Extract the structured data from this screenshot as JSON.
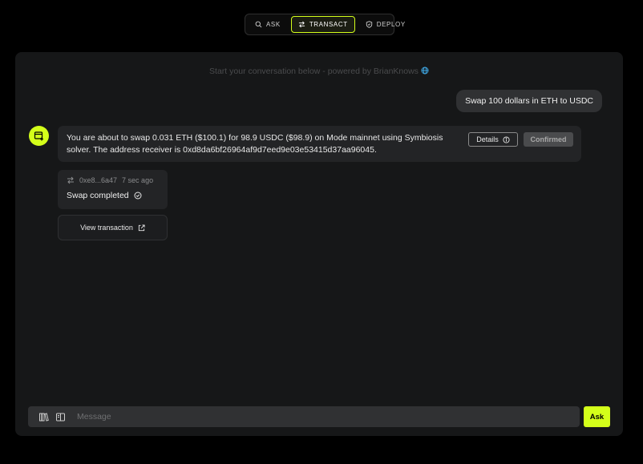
{
  "modes": [
    {
      "label": "ASK",
      "icon": "search-icon",
      "active": false
    },
    {
      "label": "TRANSACT",
      "icon": "swap-icon",
      "active": true
    },
    {
      "label": "DEPLOY",
      "icon": "shield-icon",
      "active": false
    }
  ],
  "intro": {
    "text": "Start your conversation below - powered by BrianKnows"
  },
  "user_message": "Swap 100 dollars in ETH to USDC",
  "bot_message": {
    "text": "You are about to swap 0.031 ETH ($100.1) for 98.9 USDC ($98.9) on Mode mainnet using Symbiosis solver. The address receiver is 0xd8da6bf26964af9d7eed9e03e53415d37aa96045.",
    "details_label": "Details",
    "confirmed_label": "Confirmed"
  },
  "transaction": {
    "hash": "0xe8...6a47",
    "time": "7 sec ago",
    "status": "Swap completed",
    "view_label": "View transaction"
  },
  "composer": {
    "placeholder": "Message",
    "ask_label": "Ask"
  },
  "colors": {
    "accent": "#d4ff1a",
    "background": "#000000",
    "panel": "#161718"
  }
}
